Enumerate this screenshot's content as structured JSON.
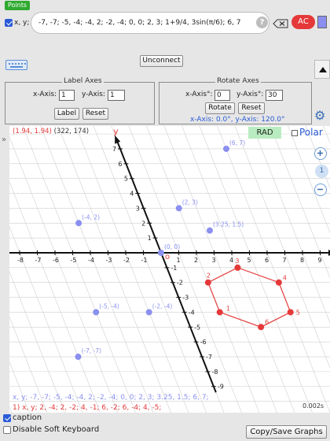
{
  "tag": "Points",
  "expr": {
    "var_label": "x, y;",
    "value": "-7, -7;  -5, -4;  -4, 2;  -2, -4;  0, 0;  2, 3;  1+9/4, 3sin(π/6);  6, 7"
  },
  "toolbar": {
    "help": "?",
    "ac": "AC"
  },
  "unconnect": "Unconnect",
  "label_axes": {
    "legend": "Label Axes",
    "x_label": "x-Axis:",
    "x_value": "1",
    "y_label": "y-Axis:",
    "y_value": "1",
    "label_btn": "Label",
    "reset_btn": "Reset"
  },
  "rotate_axes": {
    "legend": "Rotate Axes",
    "x_label": "x-Axis°:",
    "x_value": "0",
    "y_label": "y-Axis°:",
    "y_value": "30",
    "rotate_btn": "Rotate",
    "reset_btn": "Reset",
    "status": "x-Axis: 0.0°, y-Axis: 120.0°"
  },
  "graph": {
    "coord_math": "(1.94, 1.94)",
    "coord_pix": "(322, 174)",
    "rad": "RAD",
    "polar": "Polar",
    "zoom_level": "1",
    "x_axis_label": "x",
    "y_axis_label": "y",
    "x_ticks": [
      "-8",
      "-7",
      "-6",
      "-5",
      "-4",
      "-3",
      "-2",
      "-1",
      "1",
      "2",
      "3",
      "4",
      "5",
      "6",
      "7",
      "8",
      "9"
    ],
    "y_ticks": [
      "7",
      "6",
      "5",
      "4",
      "3",
      "2",
      "1",
      "-1",
      "-2",
      "-3",
      "-4",
      "-5",
      "-6",
      "-7",
      "-8",
      "-9"
    ],
    "origin_marker": "o",
    "blue_points": [
      {
        "label": "(6, 7)"
      },
      {
        "label": "(2, 3)"
      },
      {
        "label": "(-4, 2)"
      },
      {
        "label": "(3.25, 1.5)"
      },
      {
        "label": "(0, 0)"
      },
      {
        "label": "(-5, -4)"
      },
      {
        "label": "(-2, -4)"
      },
      {
        "label": "(-7, -7)"
      }
    ],
    "red_points": [
      "1",
      "2",
      "3",
      "4",
      "5",
      "6"
    ],
    "caption_blue": "x, y;  -7, -7;  -5, -4;  -4, 2;  -2, -4;  0, 0;  2, 3;  3.25, 1.5;  6, 7;",
    "caption_red": "1)  x, y;  2, -4;  2, -2;  4, -1;  6, -2;  6, -4;  4, -5;",
    "timer": "0.002s"
  },
  "bottom": {
    "caption_label": "caption",
    "soft_kb_label": "Disable Soft Keyboard",
    "copy_btn": "Copy/Save Graphs"
  },
  "colors": {
    "blue": "#8a8ff0",
    "red": "#e53939",
    "green": "#2faa2f",
    "accent": "#2a5bd7"
  }
}
